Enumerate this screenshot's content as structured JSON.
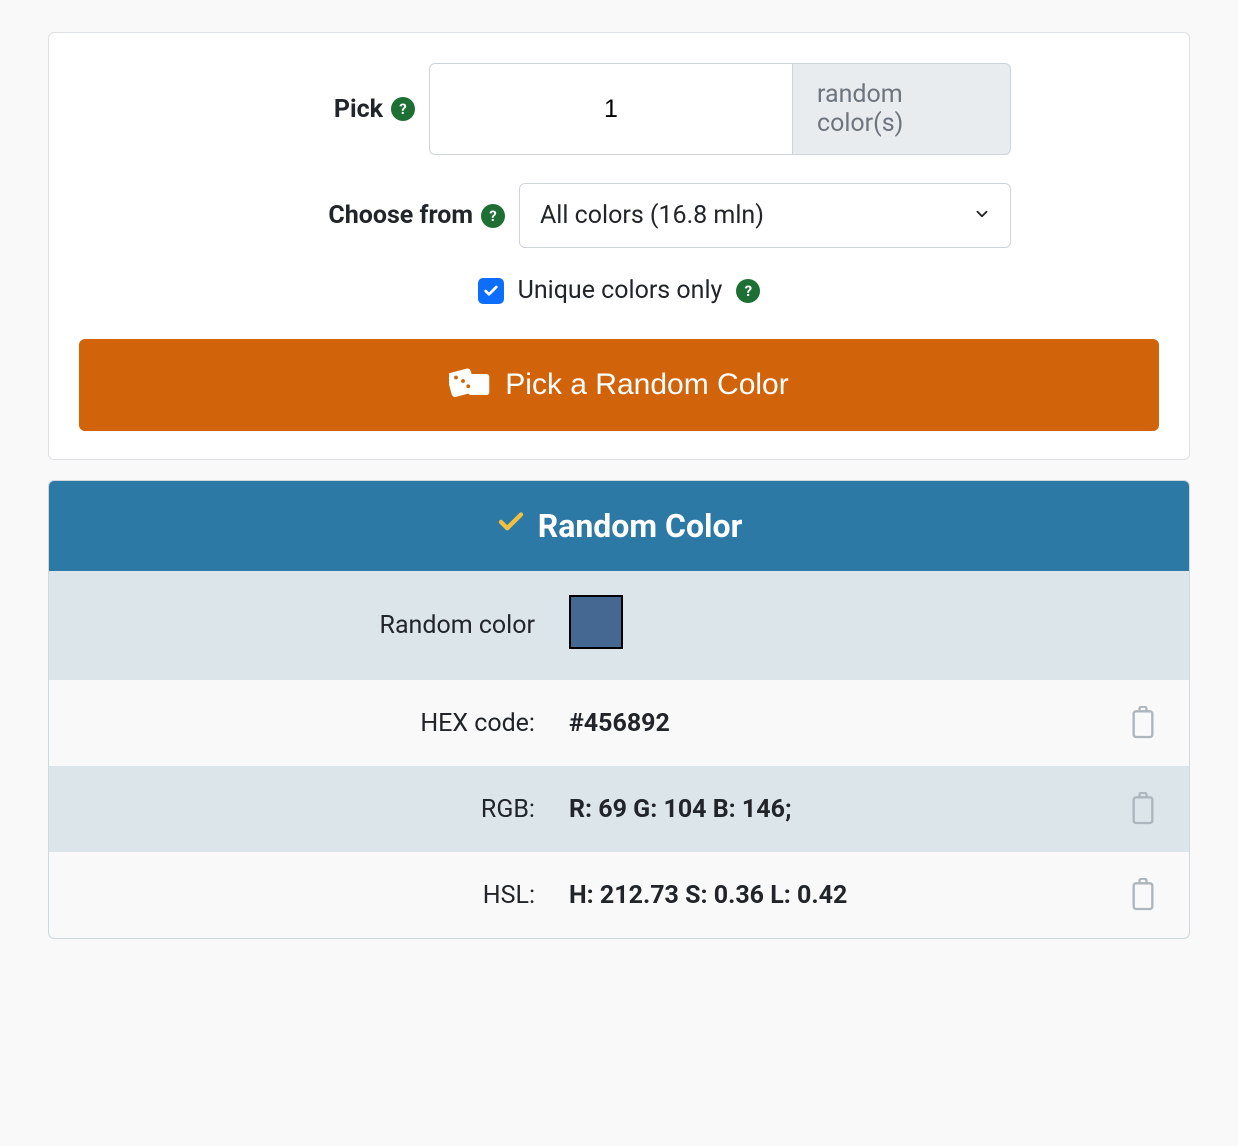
{
  "form": {
    "pick_label": "Pick",
    "pick_value": "1",
    "pick_suffix": "random color(s)",
    "choose_label": "Choose from",
    "choose_value": "All colors (16.8 mln)",
    "unique_label": "Unique colors only",
    "unique_checked": true,
    "button_label": "Pick a Random Color"
  },
  "result": {
    "header": "Random Color",
    "swatch_label": "Random color",
    "swatch_color": "#456892",
    "rows": [
      {
        "label": "HEX code:",
        "value": "#456892"
      },
      {
        "label": "RGB:",
        "value": "R: 69 G: 104 B: 146;"
      },
      {
        "label": "HSL:",
        "value": "H: 212.73 S: 0.36 L: 0.42"
      }
    ]
  }
}
